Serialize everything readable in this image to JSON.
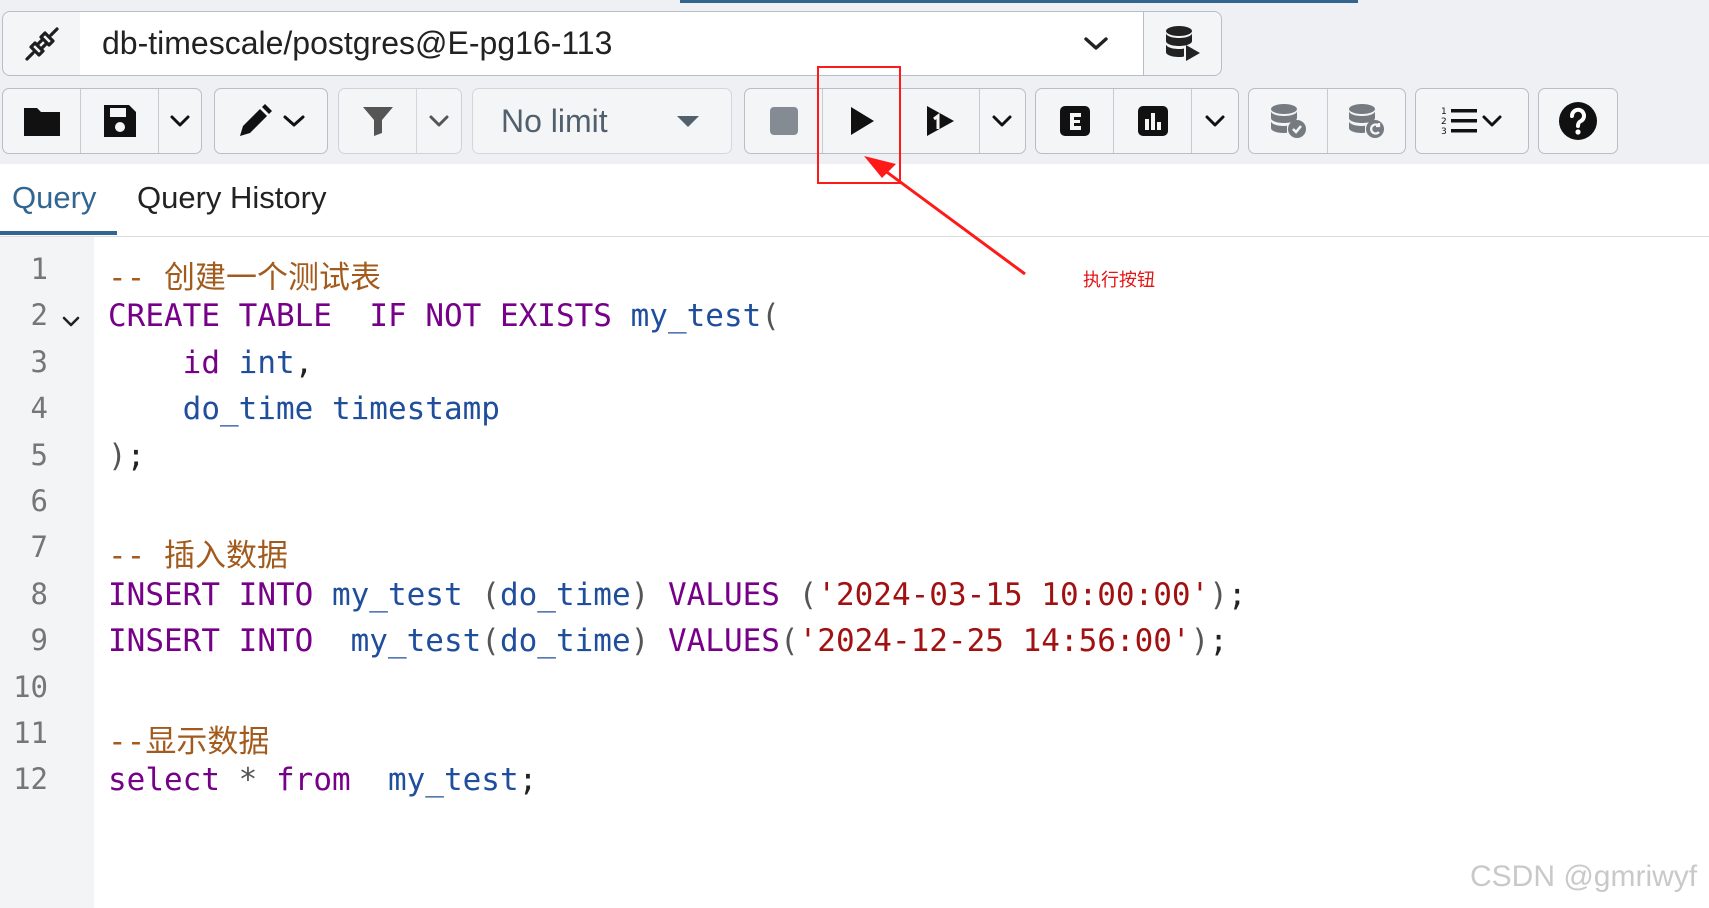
{
  "connection": {
    "value": "db-timescale/postgres@E-pg16-113"
  },
  "toolbar": {
    "limit_value": "No limit"
  },
  "tabs": [
    {
      "label": "Query",
      "active": true
    },
    {
      "label": "Query History",
      "active": false
    }
  ],
  "editor": {
    "line_numbers": [
      "1",
      "2",
      "3",
      "4",
      "5",
      "6",
      "7",
      "8",
      "9",
      "10",
      "11",
      "12"
    ],
    "lines": [
      [
        {
          "t": "-- 创建一个测试表",
          "c": "cmt"
        }
      ],
      [
        {
          "t": "CREATE",
          "c": "kw"
        },
        {
          "t": " ",
          "c": "punc"
        },
        {
          "t": "TABLE",
          "c": "kw"
        },
        {
          "t": "  ",
          "c": "punc"
        },
        {
          "t": "IF",
          "c": "kw"
        },
        {
          "t": " ",
          "c": "punc"
        },
        {
          "t": "NOT",
          "c": "kw"
        },
        {
          "t": " ",
          "c": "punc"
        },
        {
          "t": "EXISTS",
          "c": "kw"
        },
        {
          "t": " ",
          "c": "punc"
        },
        {
          "t": "my_test",
          "c": "ident"
        },
        {
          "t": "(",
          "c": "op"
        }
      ],
      [
        {
          "t": "    ",
          "c": "punc"
        },
        {
          "t": "id",
          "c": "kw"
        },
        {
          "t": " ",
          "c": "punc"
        },
        {
          "t": "int",
          "c": "ident"
        },
        {
          "t": ",",
          "c": "punc"
        }
      ],
      [
        {
          "t": "    ",
          "c": "punc"
        },
        {
          "t": "do_time",
          "c": "ident"
        },
        {
          "t": " ",
          "c": "punc"
        },
        {
          "t": "timestamp",
          "c": "ident"
        }
      ],
      [
        {
          "t": ")",
          "c": "op"
        },
        {
          "t": ";",
          "c": "punc"
        }
      ],
      [],
      [
        {
          "t": "-- 插入数据",
          "c": "cmt"
        }
      ],
      [
        {
          "t": "INSERT",
          "c": "kw"
        },
        {
          "t": " ",
          "c": "punc"
        },
        {
          "t": "INTO",
          "c": "kw"
        },
        {
          "t": " ",
          "c": "punc"
        },
        {
          "t": "my_test",
          "c": "ident"
        },
        {
          "t": " ",
          "c": "punc"
        },
        {
          "t": "(",
          "c": "op"
        },
        {
          "t": "do_time",
          "c": "ident"
        },
        {
          "t": ")",
          "c": "op"
        },
        {
          "t": " ",
          "c": "punc"
        },
        {
          "t": "VALUES",
          "c": "kw"
        },
        {
          "t": " ",
          "c": "punc"
        },
        {
          "t": "(",
          "c": "op"
        },
        {
          "t": "'2024-03-15 10:00:00'",
          "c": "str"
        },
        {
          "t": ")",
          "c": "op"
        },
        {
          "t": ";",
          "c": "punc"
        }
      ],
      [
        {
          "t": "INSERT",
          "c": "kw"
        },
        {
          "t": " ",
          "c": "punc"
        },
        {
          "t": "INTO",
          "c": "kw"
        },
        {
          "t": "  ",
          "c": "punc"
        },
        {
          "t": "my_test",
          "c": "ident"
        },
        {
          "t": "(",
          "c": "op"
        },
        {
          "t": "do_time",
          "c": "ident"
        },
        {
          "t": ")",
          "c": "op"
        },
        {
          "t": " ",
          "c": "punc"
        },
        {
          "t": "VALUES",
          "c": "kw"
        },
        {
          "t": "(",
          "c": "op"
        },
        {
          "t": "'2024-12-25 14:56:00'",
          "c": "str"
        },
        {
          "t": ")",
          "c": "op"
        },
        {
          "t": ";",
          "c": "punc"
        }
      ],
      [],
      [
        {
          "t": "--显示数据",
          "c": "cmt"
        }
      ],
      [
        {
          "t": "select",
          "c": "kw"
        },
        {
          "t": " ",
          "c": "punc"
        },
        {
          "t": "*",
          "c": "op"
        },
        {
          "t": " ",
          "c": "punc"
        },
        {
          "t": "from",
          "c": "kw"
        },
        {
          "t": "  ",
          "c": "punc"
        },
        {
          "t": "my_test",
          "c": "ident"
        },
        {
          "t": ";",
          "c": "punc"
        }
      ]
    ]
  },
  "annotation": {
    "label": "执行按钮",
    "color": "#ff1a1a"
  },
  "watermark": "CSDN @gmriwyf",
  "colors": {
    "accent": "#326690",
    "keyword": "#770088",
    "identifier": "#1f4e9c",
    "string": "#a11111",
    "comment": "#a25b1d"
  }
}
